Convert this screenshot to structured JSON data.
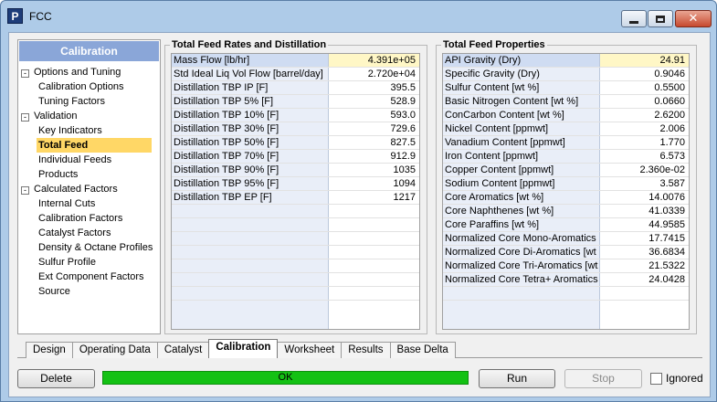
{
  "window": {
    "title": "FCC",
    "app_icon_letter": "P"
  },
  "nav": {
    "header": "Calibration",
    "items": [
      {
        "type": "group",
        "label": "Options and Tuning",
        "box": "-"
      },
      {
        "type": "child",
        "label": "Calibration Options"
      },
      {
        "type": "child",
        "label": "Tuning Factors"
      },
      {
        "type": "group",
        "label": "Validation",
        "box": "-"
      },
      {
        "type": "child",
        "label": "Key Indicators"
      },
      {
        "type": "child",
        "label": "Total Feed",
        "selected": true
      },
      {
        "type": "child",
        "label": "Individual Feeds"
      },
      {
        "type": "child",
        "label": "Products"
      },
      {
        "type": "group",
        "label": "Calculated Factors",
        "box": "-"
      },
      {
        "type": "child",
        "label": "Internal Cuts"
      },
      {
        "type": "child",
        "label": "Calibration Factors"
      },
      {
        "type": "child",
        "label": "Catalyst Factors"
      },
      {
        "type": "child",
        "label": "Density & Octane Profiles"
      },
      {
        "type": "child",
        "label": "Sulfur Profile"
      },
      {
        "type": "child",
        "label": "Ext Component Factors"
      },
      {
        "type": "child",
        "label": "Source"
      }
    ]
  },
  "feed_rates": {
    "title": "Total Feed Rates and Distillation",
    "rows": [
      {
        "label": "Mass Flow [lb/hr]",
        "value": "4.391e+05"
      },
      {
        "label": "Std Ideal Liq Vol Flow [barrel/day]",
        "value": "2.720e+04"
      },
      {
        "label": "Distillation TBP IP [F]",
        "value": "395.5"
      },
      {
        "label": "Distillation TBP 5% [F]",
        "value": "528.9"
      },
      {
        "label": "Distillation TBP 10% [F]",
        "value": "593.0"
      },
      {
        "label": "Distillation TBP 30% [F]",
        "value": "729.6"
      },
      {
        "label": "Distillation TBP 50% [F]",
        "value": "827.5"
      },
      {
        "label": "Distillation TBP 70% [F]",
        "value": "912.9"
      },
      {
        "label": "Distillation TBP 90% [F]",
        "value": "1035"
      },
      {
        "label": "Distillation TBP 95% [F]",
        "value": "1094"
      },
      {
        "label": "Distillation TBP EP [F]",
        "value": "1217"
      }
    ],
    "blank_rows": 7
  },
  "feed_props": {
    "title": "Total Feed Properties",
    "rows": [
      {
        "label": "API Gravity (Dry)",
        "value": "24.91"
      },
      {
        "label": "Specific Gravity (Dry)",
        "value": "0.9046"
      },
      {
        "label": "Sulfur Content [wt %]",
        "value": "0.5500"
      },
      {
        "label": "Basic Nitrogen Content [wt %]",
        "value": "0.0660"
      },
      {
        "label": "ConCarbon Content [wt %]",
        "value": "2.6200"
      },
      {
        "label": "Nickel Content [ppmwt]",
        "value": "2.006"
      },
      {
        "label": "Vanadium Content [ppmwt]",
        "value": "1.770"
      },
      {
        "label": "Iron Content [ppmwt]",
        "value": "6.573"
      },
      {
        "label": "Copper Content [ppmwt]",
        "value": "2.360e-02"
      },
      {
        "label": "Sodium Content [ppmwt]",
        "value": "3.587"
      },
      {
        "label": "Core Aromatics [wt %]",
        "value": "14.0076"
      },
      {
        "label": "Core Naphthenes [wt %]",
        "value": "41.0339"
      },
      {
        "label": "Core Paraffins [wt %]",
        "value": "44.9585"
      },
      {
        "label": "Normalized Core Mono-Aromatics",
        "value": "17.7415"
      },
      {
        "label": "Normalized Core Di-Aromatics [wt",
        "value": "36.6834"
      },
      {
        "label": "Normalized Core Tri-Aromatics [wt",
        "value": "21.5322"
      },
      {
        "label": "Normalized Core Tetra+ Aromatics",
        "value": "24.0428"
      }
    ],
    "blank_rows": 1
  },
  "tabs": [
    {
      "label": "Design"
    },
    {
      "label": "Operating Data"
    },
    {
      "label": "Catalyst"
    },
    {
      "label": "Calibration",
      "active": true
    },
    {
      "label": "Worksheet"
    },
    {
      "label": "Results"
    },
    {
      "label": "Base Delta"
    }
  ],
  "footer": {
    "delete_label": "Delete",
    "status_text": "OK",
    "status_color": "#13c113",
    "run_label": "Run",
    "stop_label": "Stop",
    "ignored_label": "Ignored"
  }
}
